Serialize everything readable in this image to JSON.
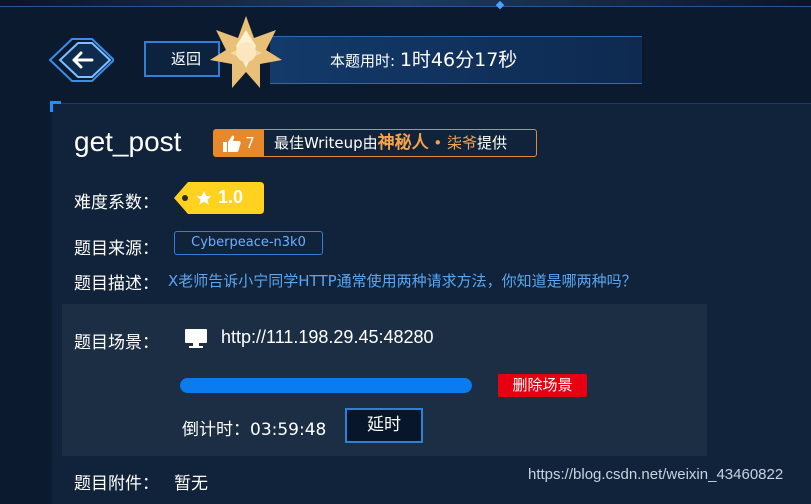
{
  "header": {
    "back_label": "返回",
    "timer_label": "本题用时:",
    "timer_value": "1时46分17秒"
  },
  "challenge": {
    "title": "get_post",
    "likes": "7",
    "writeup_prefix": "最佳Writeup由",
    "writeup_author": "神秘人",
    "writeup_sep": " • ",
    "writeup_author2": "柒爷",
    "writeup_suffix": "提供",
    "difficulty_label": "难度系数：",
    "difficulty_value": "1.0",
    "source_label": "题目来源：",
    "source_value": "Cyberpeace-n3k0",
    "desc_label": "题目描述：",
    "desc_value": "X老师告诉小宁同学HTTP通常使用两种请求方法，你知道是哪两种吗？"
  },
  "scene": {
    "label": "题目场景：",
    "url": "http://111.198.29.45:48280",
    "progress": 1.0,
    "delete_label": "删除场景",
    "countdown_label": "倒计时：",
    "countdown_value": "03:59:48",
    "extend_label": "延时"
  },
  "attachment": {
    "label": "题目附件：",
    "value": "暂无"
  },
  "watermark": "https://blog.csdn.net/weixin_43460822",
  "colors": {
    "accent": "#2f7fd8",
    "writeup": "#e7892b",
    "difficulty": "#ffd21f",
    "danger": "#e60012",
    "progress": "#0a7cf0"
  },
  "icons": [
    "back-arrow-icon",
    "star-badge-icon",
    "thumbs-up-icon",
    "star-icon",
    "monitor-icon"
  ]
}
